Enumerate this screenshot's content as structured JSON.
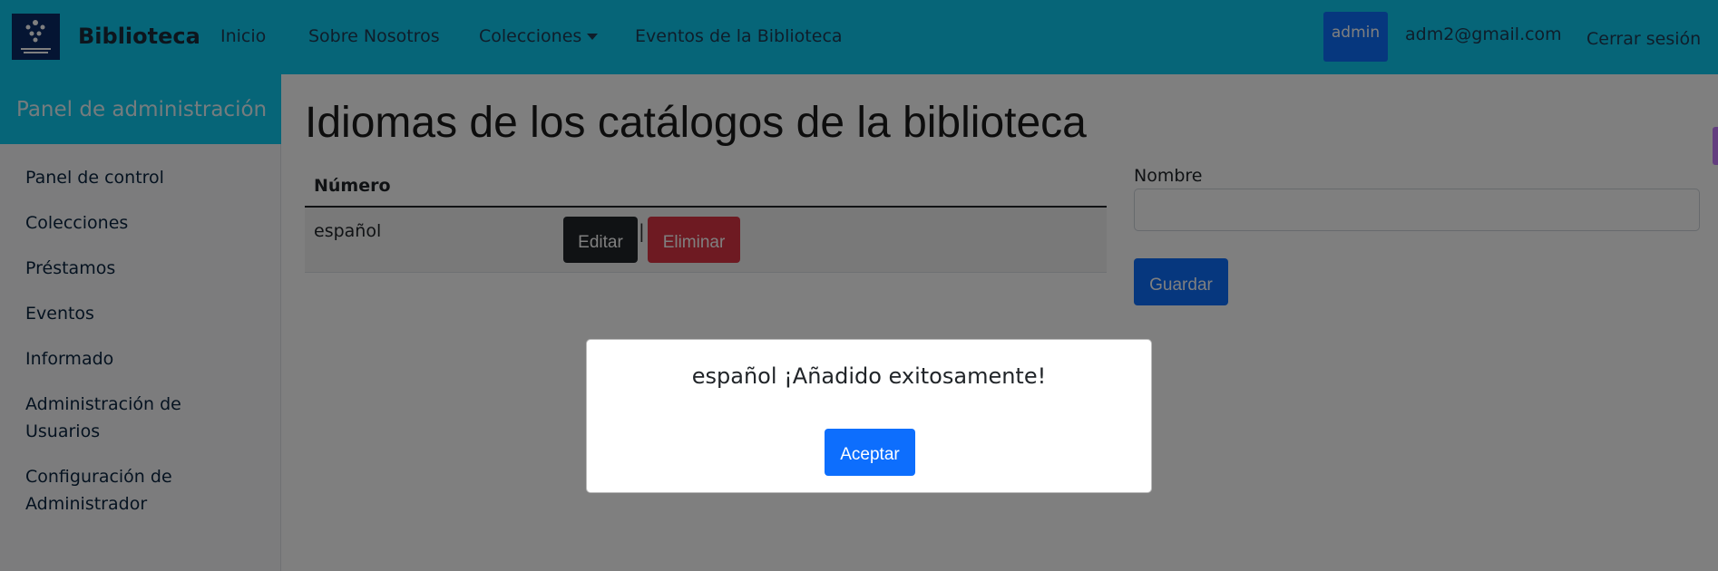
{
  "navbar": {
    "brand": "Biblioteca",
    "links": {
      "inicio": "Inicio",
      "sobre": "Sobre Nosotros",
      "colecciones": "Colecciones",
      "eventos": "Eventos de la Biblioteca"
    },
    "user_badge": "admin",
    "email": "adm2@gmail.com",
    "logout": "Cerrar sesión"
  },
  "sidebar": {
    "title": "Panel de administración",
    "items": [
      {
        "label": "Panel de control"
      },
      {
        "label": "Colecciones"
      },
      {
        "label": "Préstamos"
      },
      {
        "label": "Eventos"
      },
      {
        "label": "Informado"
      },
      {
        "label": "Administración de Usuarios"
      },
      {
        "label": "Configuración de Administrador"
      }
    ]
  },
  "main": {
    "title": "Idiomas de los catálogos de la biblioteca",
    "table": {
      "header": "Número",
      "rows": [
        {
          "name": "español",
          "edit_label": "Editar",
          "separator": "|",
          "delete_label": "Eliminar"
        }
      ]
    },
    "form": {
      "label": "Nombre",
      "value": "",
      "save_label": "Guardar"
    }
  },
  "modal": {
    "message": "español ¡Añadido exitosamente!",
    "ok_label": "Aceptar"
  },
  "colors": {
    "navbar": "#0dcaf0",
    "primary": "#0d6efd",
    "danger": "#dc3545",
    "dark": "#212529"
  }
}
